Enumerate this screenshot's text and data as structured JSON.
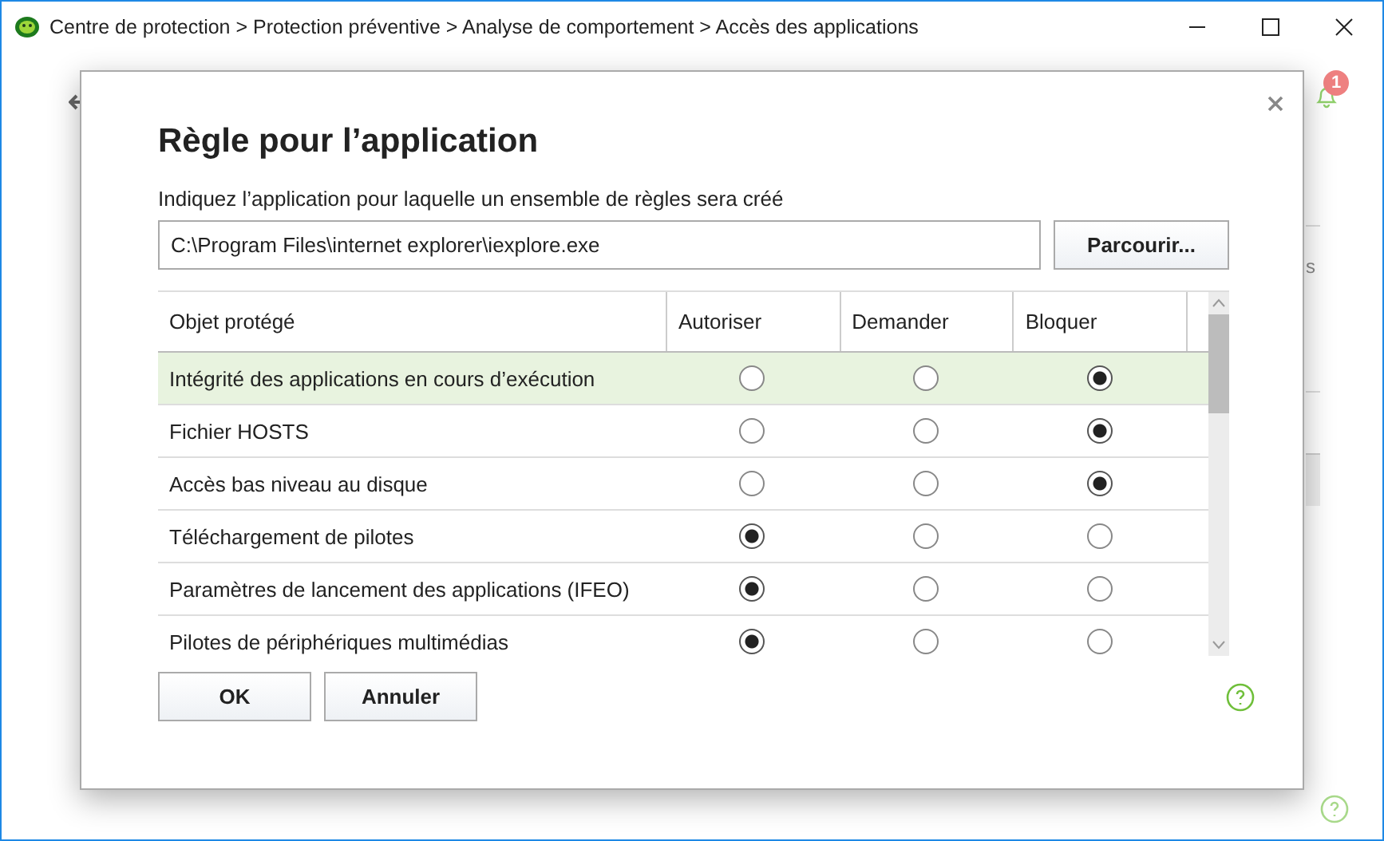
{
  "window": {
    "title": "Centre de protection > Protection préventive > Analyse de comportement > Accès des applications"
  },
  "notifications": {
    "count": "1"
  },
  "background_fragment": "s",
  "dialog": {
    "title": "Règle pour l’application",
    "path_label": "Indiquez l’application pour laquelle un ensemble de règles sera créé",
    "path_value": "C:\\Program Files\\internet explorer\\iexplore.exe",
    "browse_button": "Parcourir...",
    "table": {
      "columns": [
        "Objet protégé",
        "Autoriser",
        "Demander",
        "Bloquer"
      ],
      "rows": [
        {
          "name": "Intégrité des applications en cours d’exécution",
          "selected": true,
          "options": [
            {
              "selected": false
            },
            {
              "selected": false
            },
            {
              "selected": true
            }
          ]
        },
        {
          "name": "Fichier HOSTS",
          "selected": false,
          "options": [
            {
              "selected": false
            },
            {
              "selected": false
            },
            {
              "selected": true
            }
          ]
        },
        {
          "name": "Accès bas niveau au disque",
          "selected": false,
          "options": [
            {
              "selected": false
            },
            {
              "selected": false
            },
            {
              "selected": true
            }
          ]
        },
        {
          "name": "Téléchargement de pilotes",
          "selected": false,
          "options": [
            {
              "selected": true
            },
            {
              "selected": false
            },
            {
              "selected": false
            }
          ]
        },
        {
          "name": "Paramètres de lancement des applications (IFEO)",
          "selected": false,
          "options": [
            {
              "selected": true
            },
            {
              "selected": false
            },
            {
              "selected": false
            }
          ]
        },
        {
          "name": "Pilotes de périphériques multimédias",
          "selected": false,
          "options": [
            {
              "selected": true
            },
            {
              "selected": false
            },
            {
              "selected": false
            }
          ]
        }
      ]
    },
    "buttons": [
      "OK",
      "Annuler"
    ]
  }
}
